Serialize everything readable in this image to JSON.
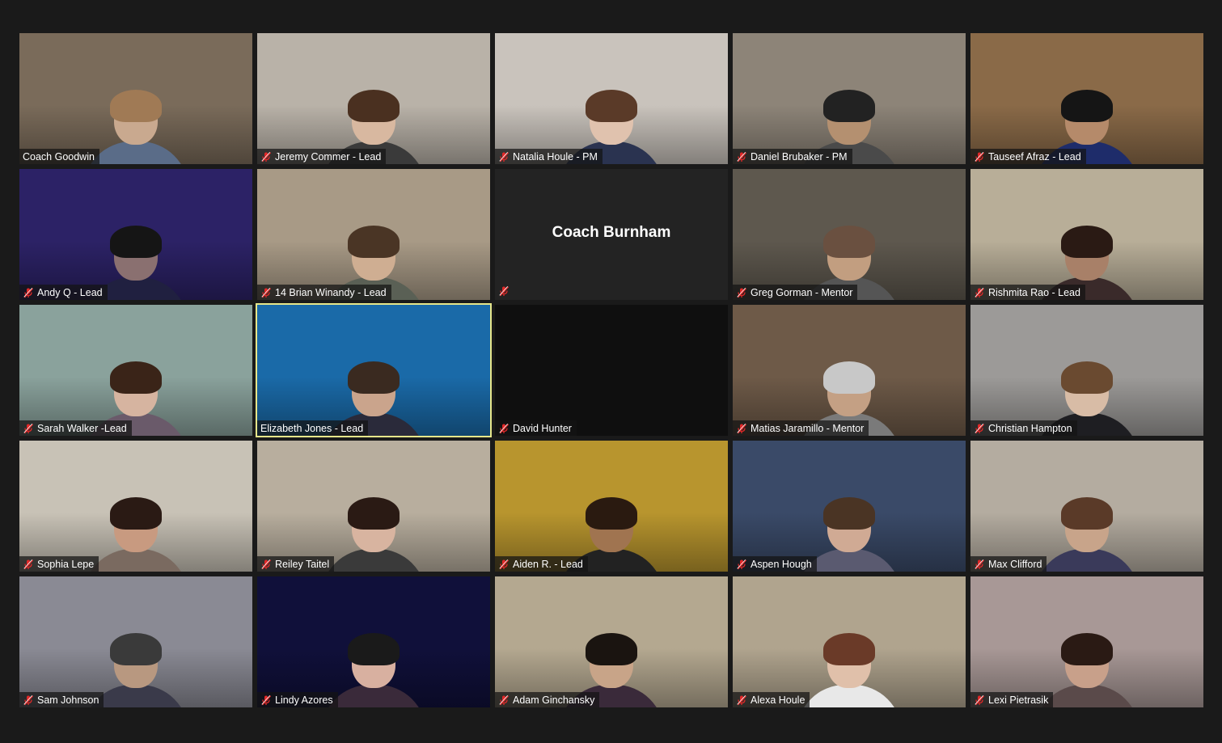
{
  "meeting": {
    "participants": [
      {
        "name": "Coach Goodwin",
        "muted": false,
        "bg": "#7a6b5a",
        "skin": "#c9a98f",
        "hair": "#a07a55",
        "shirt": "#5a6c88"
      },
      {
        "name": "Jeremy Commer - Lead",
        "muted": true,
        "bg": "#b9b2a8",
        "skin": "#d8b8a0",
        "hair": "#4a3020",
        "shirt": "#3a3a3a"
      },
      {
        "name": "Natalia Houle - PM",
        "muted": true,
        "bg": "#c9c3bc",
        "skin": "#e0c2ae",
        "hair": "#5a3a28",
        "shirt": "#2a3350"
      },
      {
        "name": "Daniel Brubaker - PM",
        "muted": true,
        "bg": "#8d8478",
        "skin": "#b49070",
        "hair": "#222222",
        "shirt": "#4a4a4a"
      },
      {
        "name": "Tauseef Afraz - Lead",
        "muted": true,
        "bg": "#8a6a48",
        "skin": "#b58a6a",
        "hair": "#151515",
        "shirt": "#1e2c6a"
      },
      {
        "name": "Andy Q - Lead",
        "muted": true,
        "bg": "#2c2266",
        "skin": "#8a7070",
        "hair": "#151515",
        "shirt": "#202040"
      },
      {
        "name": "14 Brian Winandy - Lead",
        "muted": true,
        "bg": "#a89a86",
        "skin": "#cfae92",
        "hair": "#4a3525",
        "shirt": "#5a6055"
      },
      {
        "name": "Coach Burnham",
        "muted": true,
        "camera_off": true
      },
      {
        "name": "Greg Gorman - Mentor",
        "muted": true,
        "bg": "#5e584e",
        "skin": "#c29e80",
        "hair": "#6a5040",
        "shirt": "#555555"
      },
      {
        "name": "Rishmita Rao - Lead",
        "muted": true,
        "bg": "#b8ae98",
        "skin": "#a88068",
        "hair": "#2a1a14",
        "shirt": "#3a2a2a"
      },
      {
        "name": "Sarah Walker -Lead",
        "muted": true,
        "bg": "#8aa29c",
        "skin": "#d6b4a0",
        "hair": "#3a2418",
        "shirt": "#6a5a6a"
      },
      {
        "name": "Elizabeth Jones - Lead",
        "muted": false,
        "speaking": true,
        "bg": "#1a6aa8",
        "skin": "#caa48c",
        "hair": "#3a2a20",
        "shirt": "#2a2a3a"
      },
      {
        "name": "David Hunter",
        "muted": true,
        "dark": true
      },
      {
        "name": "Matias Jaramillo - Mentor",
        "muted": true,
        "bg": "#6e5a48",
        "skin": "#c4a084",
        "hair": "#c8c8c8",
        "shirt": "#7a7a7a"
      },
      {
        "name": "Christian Hampton",
        "muted": true,
        "bg": "#9c9a98",
        "skin": "#d8bca6",
        "hair": "#6a4a30",
        "shirt": "#1e1e22"
      },
      {
        "name": "Sophia Lepe",
        "muted": true,
        "bg": "#c8c2b6",
        "skin": "#c89a80",
        "hair": "#2a1a14",
        "shirt": "#7a6a60"
      },
      {
        "name": "Reiley Taitel",
        "muted": true,
        "bg": "#b8ae9e",
        "skin": "#d8b4a0",
        "hair": "#2a1a14",
        "shirt": "#3a3a3a"
      },
      {
        "name": "Aiden R. - Lead",
        "muted": true,
        "bg": "#b8952e",
        "skin": "#a07450",
        "hair": "#2a1a10",
        "shirt": "#222222"
      },
      {
        "name": "Aspen Hough",
        "muted": true,
        "bg": "#3a4a68",
        "skin": "#d0aa94",
        "hair": "#4a3424",
        "shirt": "#5a5a70"
      },
      {
        "name": "Max Clifford",
        "muted": true,
        "bg": "#b4aca0",
        "skin": "#c8a48a",
        "hair": "#5a3a28",
        "shirt": "#3a3a5a"
      },
      {
        "name": "Sam Johnson",
        "muted": true,
        "bg": "#8a8a94",
        "skin": "#b89880",
        "hair": "#3a3a3a",
        "shirt": "#3a3a4a"
      },
      {
        "name": "Lindy Azores",
        "muted": true,
        "bg": "#10103a",
        "skin": "#d8b0a0",
        "hair": "#1a1a1a",
        "shirt": "#3a2a3a"
      },
      {
        "name": "Adam Ginchansky",
        "muted": true,
        "bg": "#b4a890",
        "skin": "#c8a488",
        "hair": "#1a1410",
        "shirt": "#3a2a3a"
      },
      {
        "name": "Alexa Houle",
        "muted": true,
        "bg": "#b0a48e",
        "skin": "#e0c0aa",
        "hair": "#6a3a28",
        "shirt": "#e8e8e8"
      },
      {
        "name": "Lexi Pietrasik",
        "muted": true,
        "bg": "#a89896",
        "skin": "#c8a08a",
        "hair": "#2a1a14",
        "shirt": "#5a4a4a"
      }
    ]
  },
  "colors": {
    "muted_icon": "#e02828",
    "speaking_outline": "#e6e68a",
    "background": "#1a1a1a"
  },
  "icons": {
    "mic_muted": "mic-muted-icon"
  }
}
